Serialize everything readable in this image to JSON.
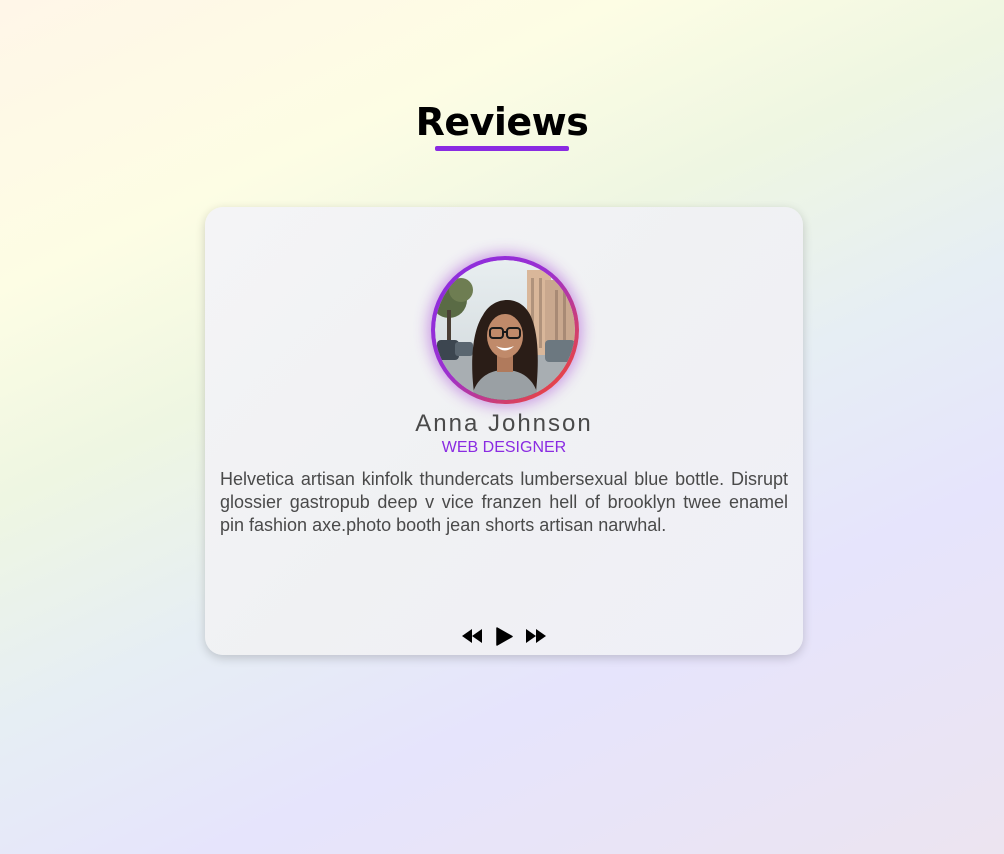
{
  "header": {
    "title": "Reviews",
    "accent_color": "#8a2be2"
  },
  "review_card": {
    "avatar_alt": "Anna Johnson",
    "name": "Anna Johnson",
    "role": "WEB DESIGNER",
    "text": "Helvetica artisan kinfolk thundercats lumbersexual blue bottle. Disrupt glossier gastropub deep v vice franzen hell of brooklyn twee enamel pin fashion axe.photo booth jean shorts artisan narwhal."
  },
  "controls": {
    "previous_icon": "rewind-icon",
    "play_icon": "play-icon",
    "next_icon": "fast-forward-icon"
  }
}
